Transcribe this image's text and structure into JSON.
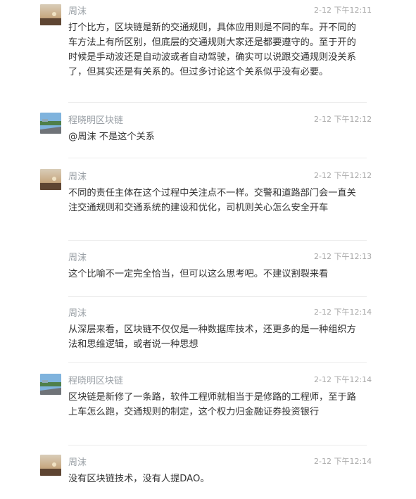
{
  "messages": [
    {
      "author": "周沫",
      "time": "2-12 下午12:11",
      "avatar": "sunset-avatar",
      "text": "打个比方，区块链是新的交通规则，具体应用则是不同的车。开不同的车方法上有所区别，但底层的交通规则大家还是都要遵守的。至于开的时候是手动波还是自动波或者自动驾驶，确实可以说跟交通规则没关系了，但其实还是有关系的。但过多讨论这个关系似乎没有必要。"
    },
    {
      "author": "程晓明区块链",
      "time": "2-12 下午12:12",
      "avatar": "road-avatar",
      "text": "@周沫 不是这个关系"
    },
    {
      "author": "周沫",
      "time": "2-12 下午12:12",
      "avatar": "sunset-avatar",
      "text": "不同的责任主体在这个过程中关注点不一样。交警和道路部门会一直关注交通规则和交通系统的建设和优化，司机则关心怎么安全开车"
    },
    {
      "author": "周沫",
      "time": "2-12 下午12:13",
      "avatar": "",
      "text": "这个比喻不一定完全恰当，但可以这么思考吧。不建议割裂来看"
    },
    {
      "author": "周沫",
      "time": "2-12 下午12:14",
      "avatar": "",
      "text": "从深层来看，区块链不仅仅是一种数据库技术，还更多的是一种组织方法和思维逻辑，或者说一种思想"
    },
    {
      "author": "程晓明区块链",
      "time": "2-12 下午12:14",
      "avatar": "road-avatar",
      "text": "区块链是新修了一条路，软件工程师就相当于是修路的工程师，至于路上车怎么跑，交通规则的制定，这个权力归金融证券投资银行"
    },
    {
      "author": "周沫",
      "time": "2-12 下午12:14",
      "avatar": "sunset-avatar",
      "text": "没有区块链技术，没有人提DAO。"
    }
  ]
}
